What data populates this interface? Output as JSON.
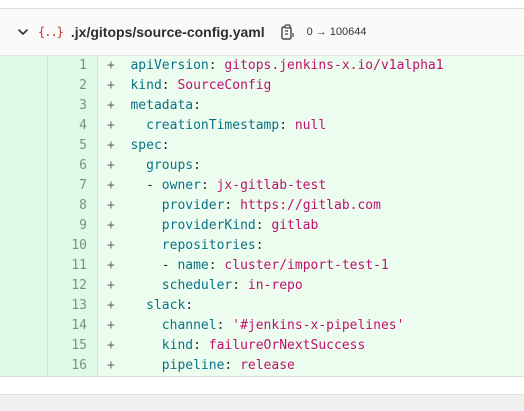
{
  "file": {
    "path": ".jx/gitops/source-config.yaml",
    "icon": "yaml-icon",
    "mode_old": "0",
    "mode_arrow": "→",
    "mode_new": "100644"
  },
  "lines": [
    {
      "num": "1",
      "indent": "",
      "dash": "",
      "key": "apiVersion",
      "value": "gitops.jenkins-x.io/v1alpha1"
    },
    {
      "num": "2",
      "indent": "",
      "dash": "",
      "key": "kind",
      "value": "SourceConfig"
    },
    {
      "num": "3",
      "indent": "",
      "dash": "",
      "key": "metadata",
      "value": ""
    },
    {
      "num": "4",
      "indent": "  ",
      "dash": "",
      "key": "creationTimestamp",
      "value": "null"
    },
    {
      "num": "5",
      "indent": "",
      "dash": "",
      "key": "spec",
      "value": ""
    },
    {
      "num": "6",
      "indent": "  ",
      "dash": "",
      "key": "groups",
      "value": ""
    },
    {
      "num": "7",
      "indent": "  ",
      "dash": "- ",
      "key": "owner",
      "value": "jx-gitlab-test"
    },
    {
      "num": "8",
      "indent": "    ",
      "dash": "",
      "key": "provider",
      "value": "https://gitlab.com"
    },
    {
      "num": "9",
      "indent": "    ",
      "dash": "",
      "key": "providerKind",
      "value": "gitlab"
    },
    {
      "num": "10",
      "indent": "    ",
      "dash": "",
      "key": "repositories",
      "value": ""
    },
    {
      "num": "11",
      "indent": "    ",
      "dash": "- ",
      "key": "name",
      "value": "cluster/import-test-1"
    },
    {
      "num": "12",
      "indent": "    ",
      "dash": "",
      "key": "scheduler",
      "value": "in-repo"
    },
    {
      "num": "13",
      "indent": "  ",
      "dash": "",
      "key": "slack",
      "value": ""
    },
    {
      "num": "14",
      "indent": "    ",
      "dash": "",
      "key": "channel",
      "value": "'#jenkins-x-pipelines'"
    },
    {
      "num": "15",
      "indent": "    ",
      "dash": "",
      "key": "kind",
      "value": "failureOrNextSuccess"
    },
    {
      "num": "16",
      "indent": "    ",
      "dash": "",
      "key": "pipeline",
      "value": "release"
    }
  ],
  "colors": {
    "added_line_bg": "#ecfdf0",
    "added_gutter_bg": "#ddfbe6",
    "key_color": "#0b7285",
    "value_color": "#c0116e"
  }
}
